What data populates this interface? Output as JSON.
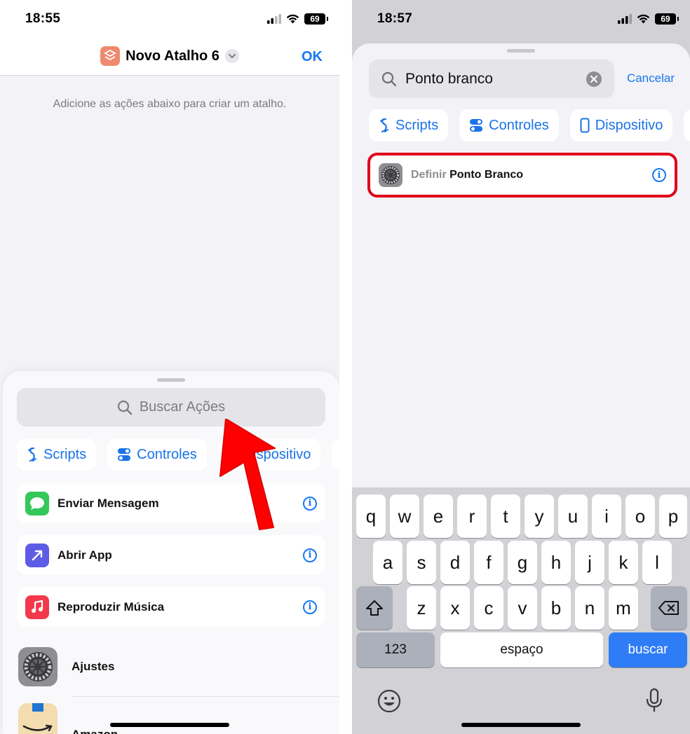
{
  "left": {
    "status": {
      "time": "18:55",
      "battery": "69"
    },
    "header": {
      "title": "Novo Atalho 6",
      "ok_label": "OK"
    },
    "hint": "Adicione as ações abaixo para criar um atalho.",
    "search_placeholder": "Buscar Ações",
    "chips": [
      "Scripts",
      "Controles",
      "Dispositivo"
    ],
    "actions": [
      {
        "label": "Enviar Mensagem",
        "icon": "messages-icon",
        "color": "#34c759"
      },
      {
        "label": "Abrir App",
        "icon": "open-app-icon",
        "color": "#5e5ce6"
      },
      {
        "label": "Reproduzir Música",
        "icon": "music-icon",
        "color": "#f2384b"
      }
    ],
    "apps": [
      "Ajustes",
      "Amazon"
    ]
  },
  "right": {
    "status": {
      "time": "18:57",
      "battery": "69"
    },
    "search_value": "Ponto branco",
    "cancel_label": "Cancelar",
    "chips": [
      "Scripts",
      "Controles",
      "Dispositivo"
    ],
    "result": {
      "verb": "Definir",
      "object": "Ponto Branco"
    },
    "keyboard": {
      "row1": [
        "q",
        "w",
        "e",
        "r",
        "t",
        "y",
        "u",
        "i",
        "o",
        "p"
      ],
      "row2": [
        "a",
        "s",
        "d",
        "f",
        "g",
        "h",
        "j",
        "k",
        "l"
      ],
      "row3": [
        "z",
        "x",
        "c",
        "v",
        "b",
        "n",
        "m"
      ],
      "numbers_label": "123",
      "space_label": "espaço",
      "search_label": "buscar"
    }
  },
  "colors": {
    "accent": "#1877f2",
    "highlight": "#e0001a",
    "arrow": "#ff0000"
  }
}
